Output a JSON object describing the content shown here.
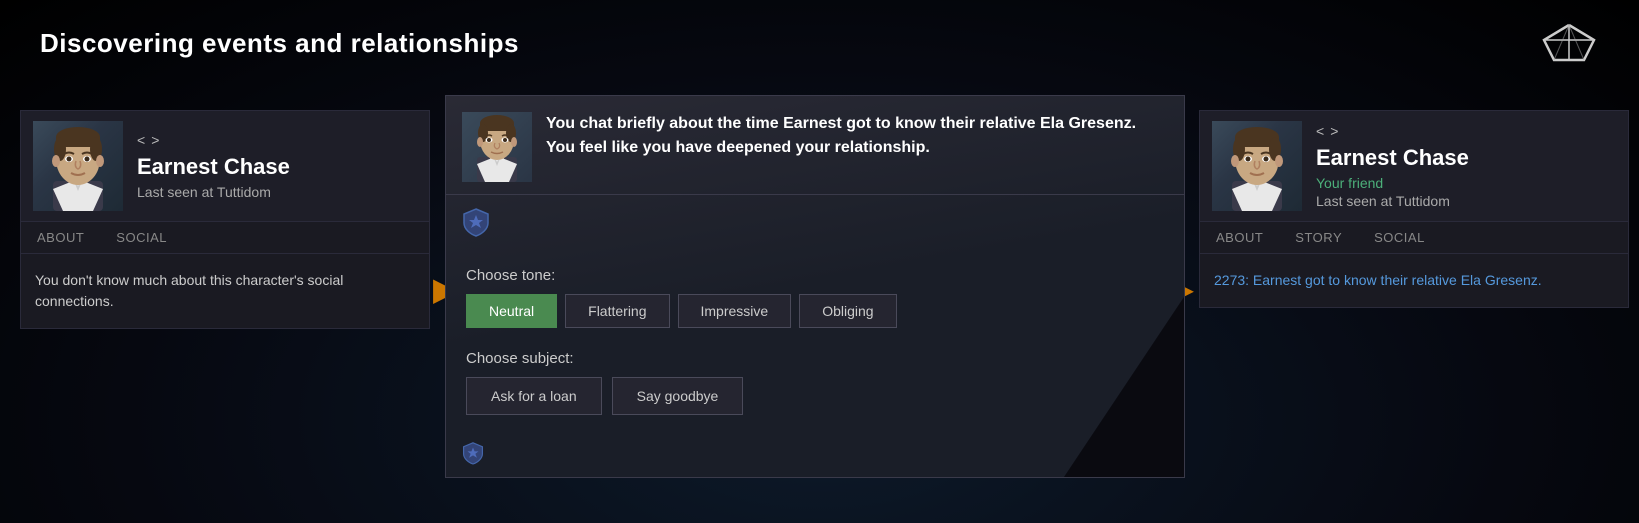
{
  "page": {
    "title": "Discovering events and relationships"
  },
  "logo": {
    "alt": "game-logo"
  },
  "left_card": {
    "nav": {
      "prev": "<",
      "next": ">"
    },
    "character_name": "Earnest Chase",
    "location": "Last seen at Tuttidom",
    "tabs": [
      "ABOUT",
      "SOCIAL"
    ],
    "body_text": "You don't know much about this character's social connections."
  },
  "right_card": {
    "nav": {
      "prev": "<",
      "next": ">"
    },
    "character_name": "Earnest Chase",
    "friend_status": "Your friend",
    "location": "Last seen at Tuttidom",
    "tabs": [
      "ABOUT",
      "STORY",
      "SOCIAL"
    ],
    "story_text": "2273: Earnest got to know their relative Ela Gresenz."
  },
  "dialogue": {
    "main_text": "You chat briefly about the time Earnest got to know their relative Ela Gresenz. You feel like you have deepened your relationship.",
    "choose_tone_label": "Choose tone:",
    "tones": [
      {
        "label": "Neutral",
        "active": true
      },
      {
        "label": "Flattering",
        "active": false
      },
      {
        "label": "Impressive",
        "active": false
      },
      {
        "label": "Obliging",
        "active": false
      }
    ],
    "choose_subject_label": "Choose subject:",
    "subjects": [
      {
        "label": "Ask for a loan"
      },
      {
        "label": "Say goodbye"
      }
    ]
  },
  "arrows": {
    "right": "▶"
  }
}
